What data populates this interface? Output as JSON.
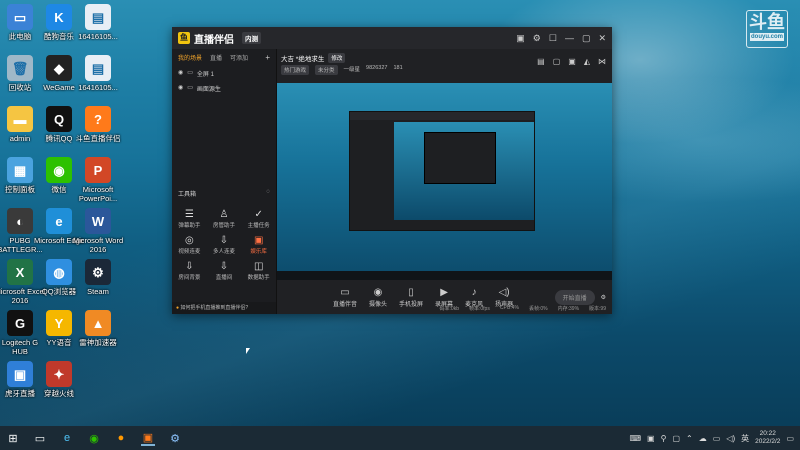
{
  "desktop": {
    "icons": [
      {
        "label": "此电脑",
        "icon": "computer-icon",
        "color": "#3b82d6",
        "glyph": "▭"
      },
      {
        "label": "酷狗音乐",
        "icon": "kugou-icon",
        "color": "#1e88e5",
        "glyph": "K"
      },
      {
        "label": "1641610​5...",
        "icon": "file-icon",
        "color": "#e8eef5",
        "glyph": "▤"
      },
      {
        "label": "回收站",
        "icon": "recycle-bin-icon",
        "color": "#9fb8c8",
        "glyph": "🗑"
      },
      {
        "label": "WeGame",
        "icon": "wegame-icon",
        "color": "#222222",
        "glyph": "◆"
      },
      {
        "label": "1641610​5...",
        "icon": "file-icon",
        "color": "#e8eef5",
        "glyph": "▤"
      },
      {
        "label": "admin",
        "icon": "folder-icon",
        "color": "#f5c542",
        "glyph": "▬"
      },
      {
        "label": "腾讯QQ",
        "icon": "qq-icon",
        "color": "#111111",
        "glyph": "Q"
      },
      {
        "label": "斗鱼直播伴侣",
        "icon": "douyu-icon",
        "color": "#ff7a1a",
        "glyph": "?"
      },
      {
        "label": "控制面板",
        "icon": "control-panel-icon",
        "color": "#4aa3df",
        "glyph": "▦"
      },
      {
        "label": "微信",
        "icon": "wechat-icon",
        "color": "#2dc100",
        "glyph": "◉"
      },
      {
        "label": "Microsoft PowerPoi...",
        "icon": "powerpoint-icon",
        "color": "#d24726",
        "glyph": "P"
      },
      {
        "label": "PUBG BATTLEGR...",
        "icon": "pubg-icon",
        "color": "#3a3a3a",
        "glyph": "◐"
      },
      {
        "label": "Microsoft Edge",
        "icon": "edge-icon",
        "color": "#1f8fd8",
        "glyph": "e"
      },
      {
        "label": "Microsoft Word 2016",
        "icon": "word-icon",
        "color": "#2b579a",
        "glyph": "W"
      },
      {
        "label": "Microsoft Excel 2016",
        "icon": "excel-icon",
        "color": "#217346",
        "glyph": "X"
      },
      {
        "label": "QQ浏览器",
        "icon": "qq-browser-icon",
        "color": "#2f8fe0",
        "glyph": "◍"
      },
      {
        "label": "Steam",
        "icon": "steam-icon",
        "color": "#1b2838",
        "glyph": "⚙"
      },
      {
        "label": "Logitech G HUB",
        "icon": "logitech-icon",
        "color": "#111111",
        "glyph": "G"
      },
      {
        "label": "YY语音",
        "icon": "yy-icon",
        "color": "#f5b700",
        "glyph": "Y"
      },
      {
        "label": "雷神加速器",
        "icon": "leishen-icon",
        "color": "#f08a24",
        "glyph": "▲"
      },
      {
        "label": "虎牙直播",
        "icon": "huya-icon",
        "color": "#2f7fd8",
        "glyph": "▣"
      },
      {
        "label": "穿越火线",
        "icon": "cf-icon",
        "color": "#c0392b",
        "glyph": "✦"
      }
    ],
    "watermark": {
      "text": "斗鱼",
      "sub": "douyu.com"
    }
  },
  "app": {
    "title": "直播伴侣",
    "badge": "内测",
    "sidebar": {
      "tabs": [
        "我的场景",
        "直播",
        "可添加"
      ],
      "sources": [
        "全屏 1",
        "画面源生"
      ],
      "tools_title": "工具箱",
      "tools": [
        {
          "label": "弹幕助手",
          "glyph": "☰",
          "hot": false
        },
        {
          "label": "房管助手",
          "glyph": "♙",
          "hot": false
        },
        {
          "label": "主播任务",
          "glyph": "✓",
          "hot": false
        },
        {
          "label": "视频连麦",
          "glyph": "◎",
          "hot": false
        },
        {
          "label": "多人连麦",
          "glyph": "⇩",
          "hot": false
        },
        {
          "label": "娱乐库",
          "glyph": "▣",
          "hot": true
        },
        {
          "label": "房间背景",
          "glyph": "⇩",
          "hot": false
        },
        {
          "label": "直播间",
          "glyph": "⇩",
          "hot": false
        },
        {
          "label": "数据助手",
          "glyph": "◫",
          "hot": false
        }
      ],
      "notice": "如何把手机直播推到直播伴侣?"
    },
    "room": {
      "title": "大吉 *绝地求生",
      "tag": "修改",
      "line2": [
        "热门游戏",
        "未分类"
      ],
      "fans": "一级星",
      "id": "9826327",
      "hot": "181"
    },
    "controls": [
      {
        "label": "直播伴音",
        "glyph": "▭"
      },
      {
        "label": "摄像头",
        "glyph": "◉"
      },
      {
        "label": "手机投屏",
        "glyph": "▯"
      },
      {
        "label": "录屏幕",
        "glyph": "▶"
      },
      {
        "label": "麦克风",
        "glyph": "♪"
      },
      {
        "label": "扬声器",
        "glyph": "◁)"
      }
    ],
    "start_label": "开始直播",
    "status": [
      "码率:0kb",
      "帧率:0fps",
      "CPU:4%",
      "丢帧:0%",
      "内存:39%",
      "版本:99"
    ]
  },
  "taskbar": {
    "time": "20:22",
    "date": "2022/2/2",
    "lang": "英"
  }
}
